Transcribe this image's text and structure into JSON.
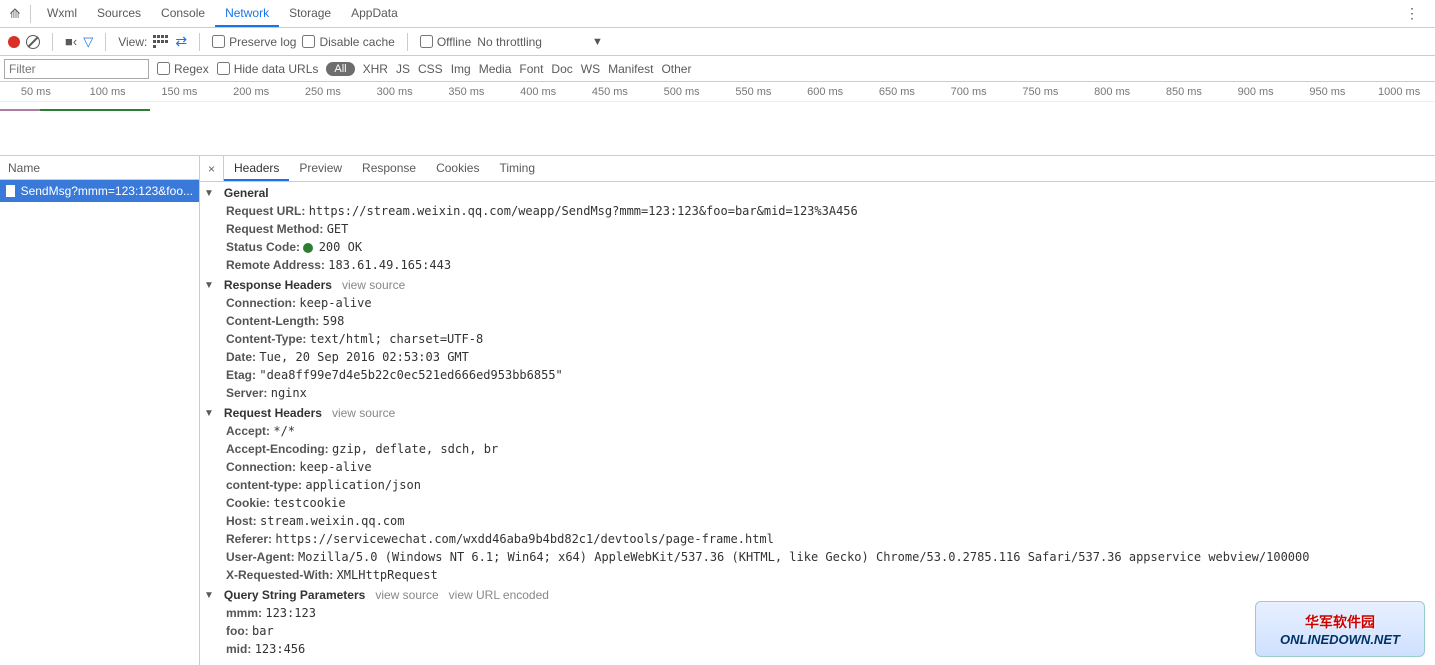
{
  "topTabs": {
    "t0": "Wxml",
    "t1": "Sources",
    "t2": "Console",
    "t3": "Network",
    "t4": "Storage",
    "t5": "AppData"
  },
  "toolbar": {
    "viewLabel": "View:",
    "preserve": "Preserve log",
    "disableCache": "Disable cache",
    "offline": "Offline",
    "throttle": "No throttling"
  },
  "filterbar": {
    "placeholder": "Filter",
    "regex": "Regex",
    "hide": "Hide data URLs",
    "all": "All",
    "types": {
      "xhr": "XHR",
      "js": "JS",
      "css": "CSS",
      "img": "Img",
      "media": "Media",
      "font": "Font",
      "doc": "Doc",
      "ws": "WS",
      "manifest": "Manifest",
      "other": "Other"
    }
  },
  "timeline": {
    "t1": "50 ms",
    "t2": "100 ms",
    "t3": "150 ms",
    "t4": "200 ms",
    "t5": "250 ms",
    "t6": "300 ms",
    "t7": "350 ms",
    "t8": "400 ms",
    "t9": "450 ms",
    "t10": "500 ms",
    "t11": "550 ms",
    "t12": "600 ms",
    "t13": "650 ms",
    "t14": "700 ms",
    "t15": "750 ms",
    "t16": "800 ms",
    "t17": "850 ms",
    "t18": "900 ms",
    "t19": "950 ms",
    "t20": "1000 ms"
  },
  "left": {
    "header": "Name",
    "row0": "SendMsg?mmm=123:123&foo..."
  },
  "detailTabs": {
    "headers": "Headers",
    "preview": "Preview",
    "response": "Response",
    "cookies": "Cookies",
    "timing": "Timing"
  },
  "viewSource": "view source",
  "viewURL": "view URL encoded",
  "sections": {
    "general": "General",
    "resp": "Response Headers",
    "req": "Request Headers",
    "qsp": "Query String Parameters"
  },
  "general": {
    "k_url": "Request URL:",
    "v_url": "https://stream.weixin.qq.com/weapp/SendMsg?mmm=123:123&foo=bar&mid=123%3A456",
    "k_method": "Request Method:",
    "v_method": "GET",
    "k_status": "Status Code:",
    "v_status": "200 OK",
    "k_remote": "Remote Address:",
    "v_remote": "183.61.49.165:443"
  },
  "resp": {
    "k_conn": "Connection:",
    "v_conn": "keep-alive",
    "k_len": "Content-Length:",
    "v_len": "598",
    "k_ctype": "Content-Type:",
    "v_ctype": "text/html; charset=UTF-8",
    "k_date": "Date:",
    "v_date": "Tue, 20 Sep 2016 02:53:03 GMT",
    "k_etag": "Etag:",
    "v_etag": "\"dea8ff99e7d4e5b22c0ec521ed666ed953bb6855\"",
    "k_server": "Server:",
    "v_server": "nginx"
  },
  "req": {
    "k_accept": "Accept:",
    "v_accept": "*/*",
    "k_ae": "Accept-Encoding:",
    "v_ae": "gzip, deflate, sdch, br",
    "k_conn": "Connection:",
    "v_conn": "keep-alive",
    "k_ctype": "content-type:",
    "v_ctype": "application/json",
    "k_cookie": "Cookie:",
    "v_cookie": "testcookie",
    "k_host": "Host:",
    "v_host": "stream.weixin.qq.com",
    "k_ref": "Referer:",
    "v_ref": "https://servicewechat.com/wxdd46aba9b4bd82c1/devtools/page-frame.html",
    "k_ua": "User-Agent:",
    "v_ua": "Mozilla/5.0 (Windows NT 6.1; Win64; x64) AppleWebKit/537.36 (KHTML, like Gecko) Chrome/53.0.2785.116 Safari/537.36 appservice webview/100000",
    "k_xreq": "X-Requested-With:",
    "v_xreq": "XMLHttpRequest"
  },
  "qsp": {
    "k_mmm": "mmm:",
    "v_mmm": "123:123",
    "k_foo": "foo:",
    "v_foo": "bar",
    "k_mid": "mid:",
    "v_mid": "123:456"
  },
  "watermark": {
    "cn": "华军软件园",
    "en": "ONLINEDOWN.NET"
  }
}
